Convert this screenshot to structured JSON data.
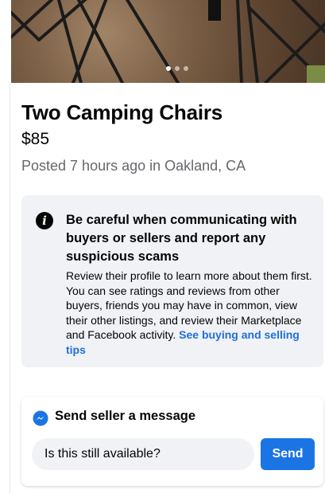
{
  "listing": {
    "title": "Two Camping Chairs",
    "price": "$85",
    "posted": "Posted 7 hours ago in Oakland, CA",
    "photo_count": 3,
    "active_photo_index": 0
  },
  "safety": {
    "icon": "info-icon",
    "heading": "Be careful when communicating with buyers or sellers and report any suspicious scams",
    "body": "Review their profile to learn more about them first. You can see ratings and reviews from other buyers, friends you may have in common, view their other listings, and review their Marketplace and Facebook activity. ",
    "link": "See buying and selling tips"
  },
  "message": {
    "icon": "messenger-icon",
    "title": "Send seller a message",
    "input_value": "Is this still available?",
    "send_label": "Send"
  },
  "colors": {
    "accent": "#1b74e4",
    "link": "#216fdb",
    "secondary_text": "#65676b",
    "panel_bg": "#f0f2f5"
  }
}
